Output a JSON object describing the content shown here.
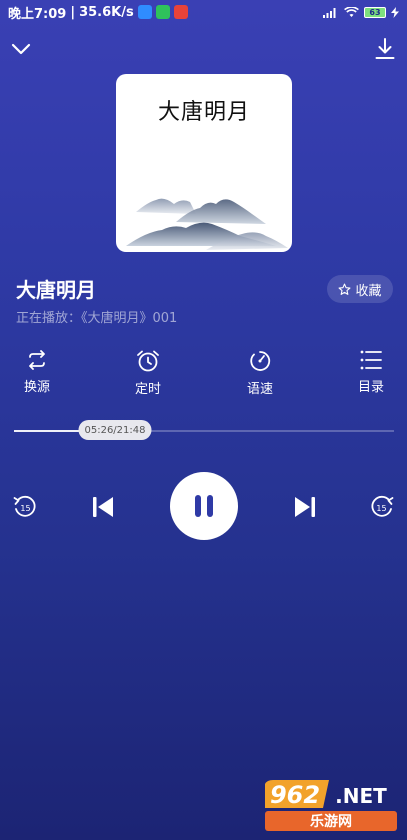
{
  "status": {
    "time": "晚上7:09",
    "separator": "|",
    "speed": "35.6K/s",
    "battery": "63"
  },
  "album": {
    "cover_title": "大唐明月"
  },
  "track": {
    "title": "大唐明月",
    "now_playing": "正在播放：《大唐明月》001"
  },
  "favorite": {
    "icon": "star-outline-icon",
    "label": "收藏"
  },
  "actions": [
    {
      "label": "换源",
      "icon": "switch-source-icon"
    },
    {
      "label": "定时",
      "icon": "alarm-clock-icon"
    },
    {
      "label": "语速",
      "icon": "speedometer-icon"
    },
    {
      "label": "目录",
      "icon": "list-icon"
    }
  ],
  "progress": {
    "label": "05:26/21:48",
    "fraction": 0.249
  },
  "controls": {
    "rewind_seconds": "15",
    "forward_seconds": "15"
  },
  "watermark": {
    "logo_text": "962.NET",
    "sub_text": "乐游网"
  },
  "colors": {
    "background_top": "#3a40b4",
    "background_bottom": "#1c2474",
    "accent": "#ffffff"
  }
}
